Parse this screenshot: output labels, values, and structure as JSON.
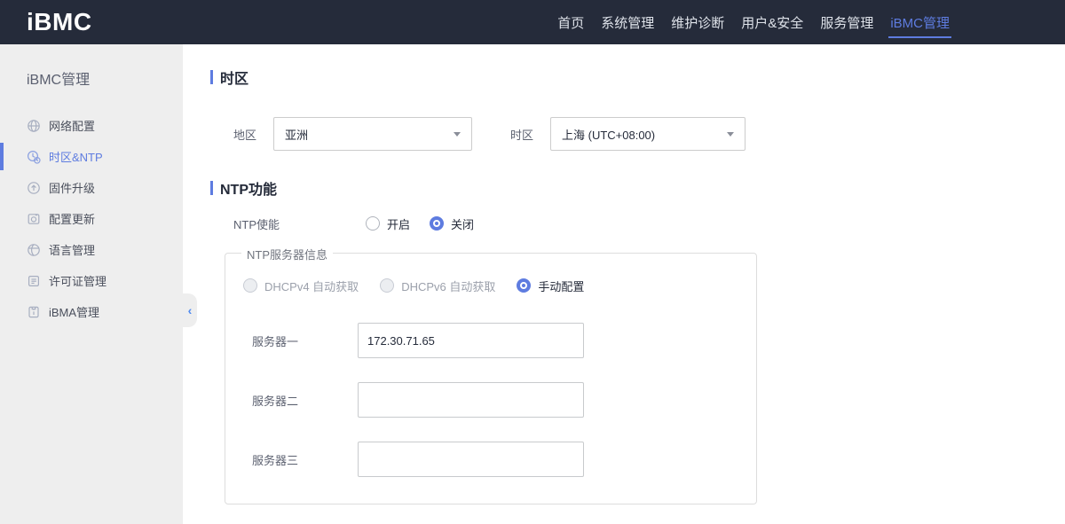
{
  "colors": {
    "accent": "#5e7ce0",
    "topbar_bg": "#252b3a",
    "sidebar_bg": "#eeeeee",
    "text_dark": "#252b3a"
  },
  "topbar": {
    "logo": "iBMC",
    "nav": [
      {
        "label": "首页",
        "active": false
      },
      {
        "label": "系统管理",
        "active": false
      },
      {
        "label": "维护诊断",
        "active": false
      },
      {
        "label": "用户&安全",
        "active": false
      },
      {
        "label": "服务管理",
        "active": false
      },
      {
        "label": "iBMC管理",
        "active": true
      }
    ]
  },
  "sidebar": {
    "title": "iBMC管理",
    "items": [
      {
        "label": "网络配置",
        "icon": "network-icon",
        "active": false
      },
      {
        "label": "时区&NTP",
        "icon": "timezone-icon",
        "active": true
      },
      {
        "label": "固件升级",
        "icon": "firmware-upgrade-icon",
        "active": false
      },
      {
        "label": "配置更新",
        "icon": "config-update-icon",
        "active": false
      },
      {
        "label": "语言管理",
        "icon": "language-icon",
        "active": false
      },
      {
        "label": "许可证管理",
        "icon": "license-icon",
        "active": false
      },
      {
        "label": "iBMA管理",
        "icon": "ibma-icon",
        "active": false
      }
    ],
    "collapse_icon": "‹"
  },
  "main": {
    "timezone": {
      "title": "时区",
      "region_label": "地区",
      "region_value": "亚洲",
      "tz_label": "时区",
      "tz_value": "上海 (UTC+08:00)"
    },
    "ntp": {
      "title": "NTP功能",
      "enable_label": "NTP使能",
      "enable_options": [
        {
          "label": "开启",
          "checked": false
        },
        {
          "label": "关闭",
          "checked": true
        }
      ],
      "group_legend": "NTP服务器信息",
      "mode_options": [
        {
          "label": "DHCPv4 自动获取",
          "checked": false,
          "disabled": true
        },
        {
          "label": "DHCPv6 自动获取",
          "checked": false,
          "disabled": true
        },
        {
          "label": "手动配置",
          "checked": true,
          "disabled": false
        }
      ],
      "servers": [
        {
          "label": "服务器一",
          "value": "172.30.71.65"
        },
        {
          "label": "服务器二",
          "value": ""
        },
        {
          "label": "服务器三",
          "value": ""
        }
      ]
    }
  }
}
